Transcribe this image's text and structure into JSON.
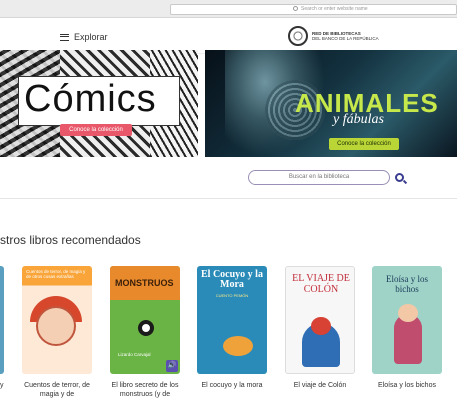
{
  "browser": {
    "address_placeholder": "Search or enter website name"
  },
  "header": {
    "menu_label": "Explorar",
    "logo_line1": "RED DE BIBLIOTECAS",
    "logo_line2": "DEL BANCO DE LA REPÚBLICA"
  },
  "banners": [
    {
      "title": "Cómics",
      "cta": "Conoce la colección"
    },
    {
      "title": "ANIMALES",
      "subtitle": "y fábulas",
      "cta": "Conoce la colección"
    }
  ],
  "search": {
    "placeholder": "Buscar en la biblioteca"
  },
  "section": {
    "title": "stros libros recomendados"
  },
  "books": [
    {
      "title": "y"
    },
    {
      "title": "Cuentos de terror, de magia y de",
      "cover_text": "Cuentos de terror, de magia y de otros cosas extrañas"
    },
    {
      "title": "El libro secreto de los monstruos (y de",
      "cover_text": "MONSTRUOS",
      "author": "Lizardo Carvajal",
      "audio": "🔊"
    },
    {
      "title": "El cocuyo y la mora",
      "cover_text": "El Cocuyo y la Mora",
      "cover_sub": "CUENTO PEMÓN"
    },
    {
      "title": "El viaje de Colón",
      "cover_text": "EL VIAJE DE COLÓN"
    },
    {
      "title": "Eloísa y los bichos",
      "cover_text": "Eloísa y los bichos"
    }
  ]
}
